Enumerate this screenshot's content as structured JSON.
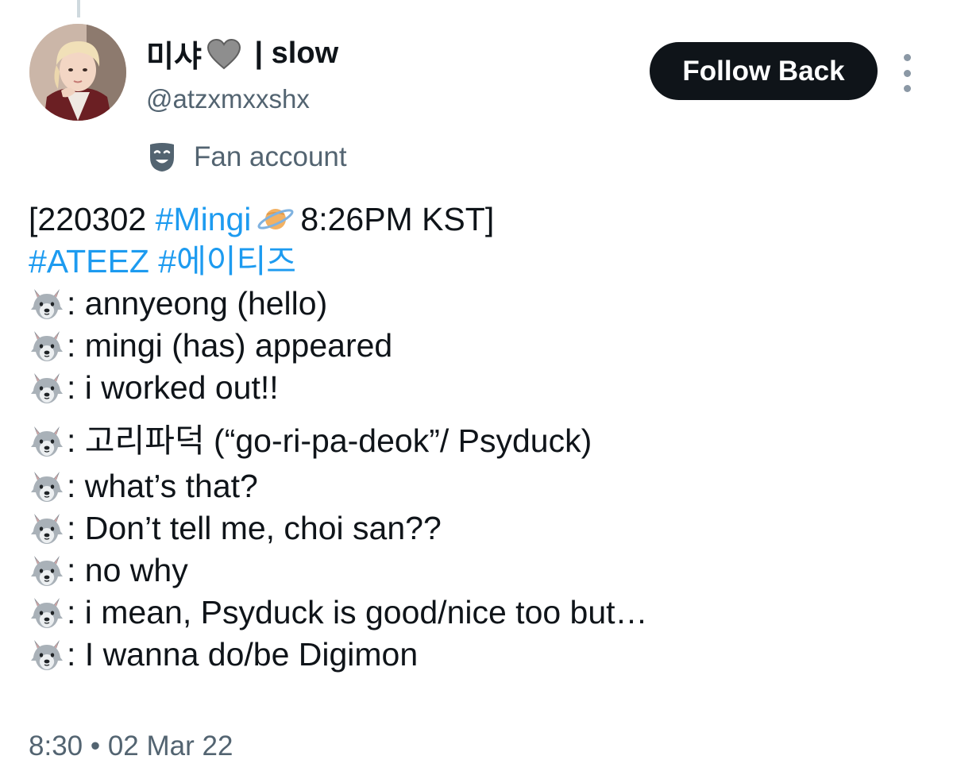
{
  "tweet": {
    "author": {
      "display_name_prefix": "미샤",
      "display_name_suffix": " | slow",
      "heart_color": "#8e8e8e",
      "handle": "@atzxmxxshx",
      "account_label": "Fan account",
      "avatar": "profile-photo"
    },
    "follow_button_label": "Follow Back",
    "header": {
      "open_bracket": "[220302 ",
      "hashtag_mingi": "#Mingi",
      "time_close": "8:26PM KST]",
      "planet_icon": "ringed-planet"
    },
    "hashtag_line": "#ATEEZ #에이티즈",
    "speaker_icon": "wolf-face",
    "lines": [
      ": annyeong (hello)",
      ": mingi (has) appeared",
      ": i worked out!!",
      ": 고리파덕 (“go-ri-pa-deok”/ Psyduck)",
      ": what’s that?",
      ": Don’t tell me, choi san??",
      ": no why",
      ": i mean, Psyduck is good/nice too but…",
      ": I wanna do/be Digimon"
    ],
    "timestamp": "8:30 • 02 Mar 22",
    "colors": {
      "link": "#1d9bf0",
      "text": "#0f1419",
      "muted": "#536471",
      "button_bg": "#0f1419",
      "button_text": "#ffffff"
    }
  }
}
